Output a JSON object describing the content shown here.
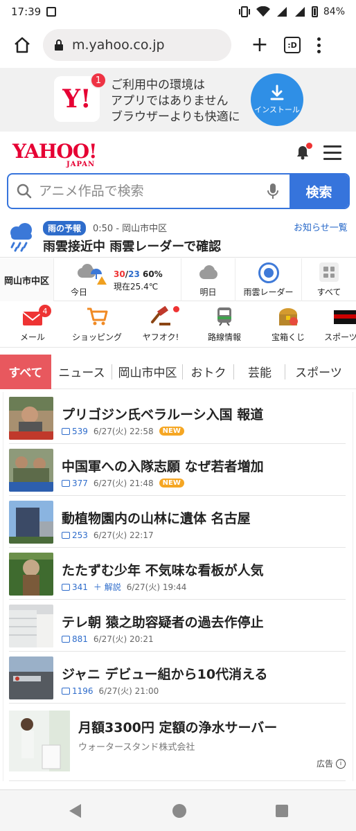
{
  "status_bar": {
    "time": "17:39",
    "battery": "84%"
  },
  "browser": {
    "url": "m.yahoo.co.jp",
    "tabs_label": ":D"
  },
  "app_banner": {
    "badge": "1",
    "logo_text": "Y!",
    "line1": "ご利用中の環境は",
    "line2": "アプリではありません",
    "line3": "ブラウザーよりも快適に",
    "install_label": "インストール"
  },
  "header": {
    "logo": "YAHOO!",
    "logo_sub": "JAPAN"
  },
  "search": {
    "placeholder": "アニメ作品で検索",
    "button_label": "検索"
  },
  "alert": {
    "badge": "雨の予報",
    "meta": "0:50 - 岡山市中区",
    "link": "お知らせ一覧",
    "title": "雨雲接近中 雨雲レーダーで確認"
  },
  "weather": {
    "area": "岡山市中区",
    "today_label": "今日",
    "high": "30",
    "low": "23",
    "rain": "60%",
    "now": "現在25.4℃",
    "tomorrow_label": "明日",
    "radar_label": "雨雲レーダー",
    "all_label": "すべて"
  },
  "services": [
    {
      "label": "メール",
      "icon": "mail-icon",
      "badge": "4"
    },
    {
      "label": "ショッピング",
      "icon": "shopping-cart-icon"
    },
    {
      "label": "ヤフオク!",
      "icon": "auction-hammer-icon"
    },
    {
      "label": "路線情報",
      "icon": "train-icon"
    },
    {
      "label": "宝箱くじ",
      "icon": "treasure-box-icon"
    },
    {
      "label": "スポーツ",
      "icon": "sports-icon"
    }
  ],
  "category_tabs": [
    "すべて",
    "ニュース",
    "岡山市中区",
    "おトク",
    "芸能",
    "スポーツ"
  ],
  "news": [
    {
      "title": "プリゴジン氏ベラルーシ入国 報道",
      "comments": "539",
      "date": "6/27(火) 22:58",
      "new": "NEW"
    },
    {
      "title": "中国軍への入隊志願 なぜ若者増加",
      "comments": "377",
      "date": "6/27(火) 21:48",
      "new": "NEW"
    },
    {
      "title": "動植物園内の山林に遺体 名古屋",
      "comments": "253",
      "date": "6/27(火) 22:17"
    },
    {
      "title": "たたずむ少年 不気味な看板が人気",
      "comments": "341",
      "extra": "＋ 解説",
      "date": "6/27(火) 19:44"
    },
    {
      "title": "テレ朝 猿之助容疑者の過去作停止",
      "comments": "881",
      "date": "6/27(火) 20:21"
    },
    {
      "title": "ジャニ デビュー組から10代消える",
      "comments": "1196",
      "date": "6/27(火) 21:00"
    }
  ],
  "ad": {
    "title": "月額3300円 定額の浄水サーバー",
    "sponsor": "ウォータースタンド株式会社",
    "label": "広告"
  }
}
